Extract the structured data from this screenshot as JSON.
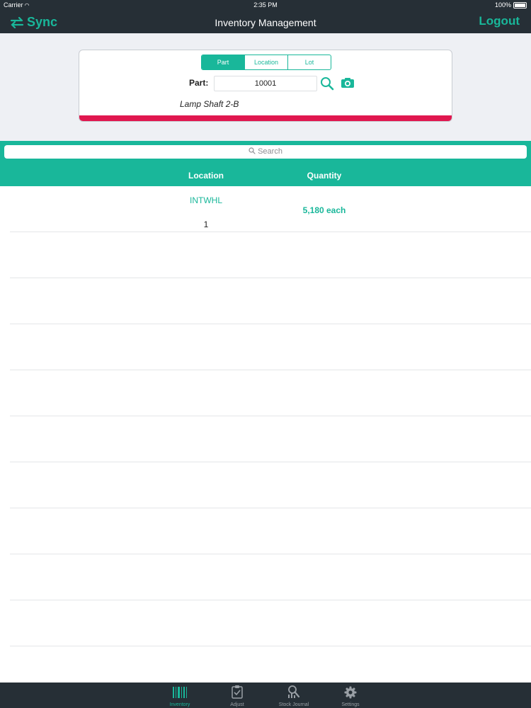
{
  "status_bar": {
    "carrier": "Carrier",
    "time": "2:35 PM",
    "battery": "100%"
  },
  "nav": {
    "sync_label": "Sync",
    "title": "Inventory Management",
    "logout_label": "Logout"
  },
  "segments": [
    {
      "label": "Part",
      "active": true
    },
    {
      "label": "Location",
      "active": false
    },
    {
      "label": "Lot",
      "active": false
    }
  ],
  "part": {
    "label": "Part:",
    "value": "10001",
    "description": "Lamp Shaft 2-B"
  },
  "search": {
    "placeholder": "Search"
  },
  "table": {
    "columns": [
      "Location",
      "Quantity"
    ],
    "rows": [
      {
        "location": "INTWHL",
        "lot": "1",
        "quantity": "5,180 each"
      }
    ]
  },
  "tabs": [
    {
      "label": "Inventory",
      "icon": "barcode-icon",
      "active": true
    },
    {
      "label": "Adjust",
      "icon": "clipboard-check-icon",
      "active": false
    },
    {
      "label": "Stock Journal",
      "icon": "stock-journal-icon",
      "active": false
    },
    {
      "label": "Settings",
      "icon": "gear-icon",
      "active": false
    }
  ],
  "colors": {
    "accent": "#19b79a",
    "dark": "#262f36",
    "alert": "#e0174f"
  }
}
